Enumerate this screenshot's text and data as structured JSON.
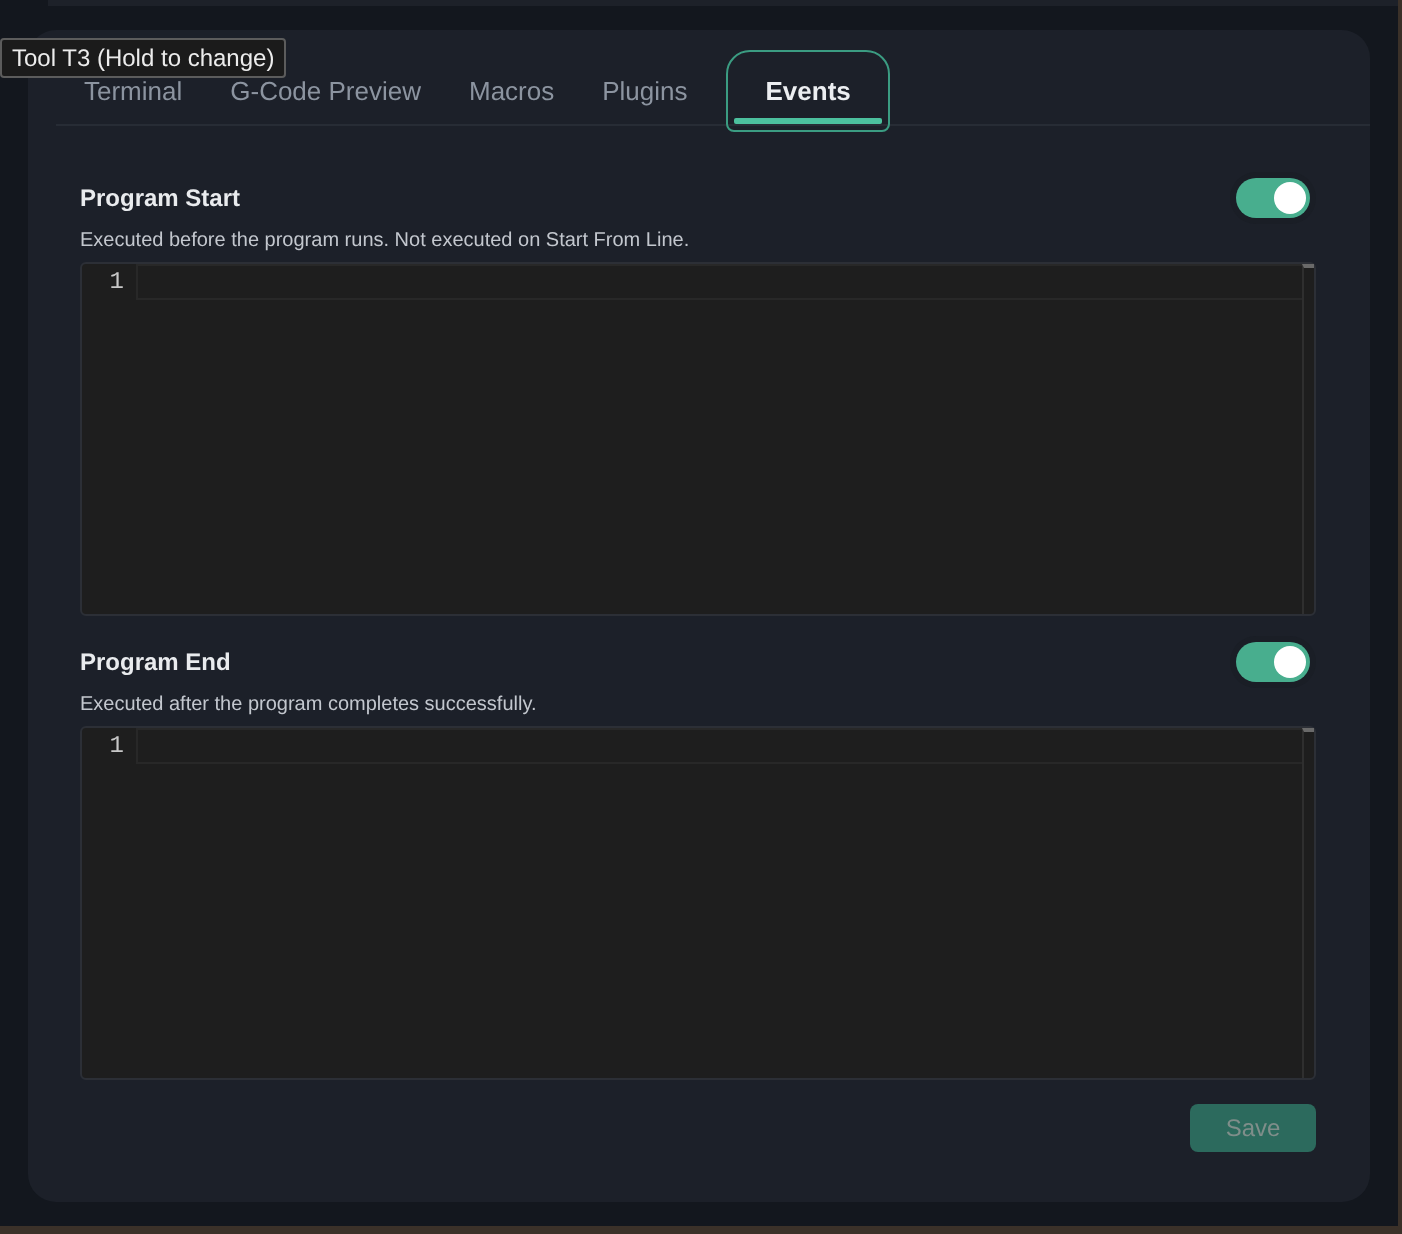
{
  "tooltip": {
    "text": "Tool T3 (Hold to change)"
  },
  "tabs": [
    {
      "label": "Terminal",
      "selected": false
    },
    {
      "label": "G-Code Preview",
      "selected": false
    },
    {
      "label": "Macros",
      "selected": false
    },
    {
      "label": "Plugins",
      "selected": false
    },
    {
      "label": "Events",
      "selected": true
    }
  ],
  "events": [
    {
      "title": "Program Start",
      "enabled": true,
      "description": "Executed before the program runs. Not executed on Start From Line.",
      "editor": {
        "line_numbers": [
          "1"
        ]
      }
    },
    {
      "title": "Program End",
      "enabled": true,
      "description": "Executed after the program completes successfully.",
      "editor": {
        "line_numbers": [
          "1"
        ]
      }
    }
  ],
  "save_button": {
    "label": "Save",
    "disabled": true
  }
}
